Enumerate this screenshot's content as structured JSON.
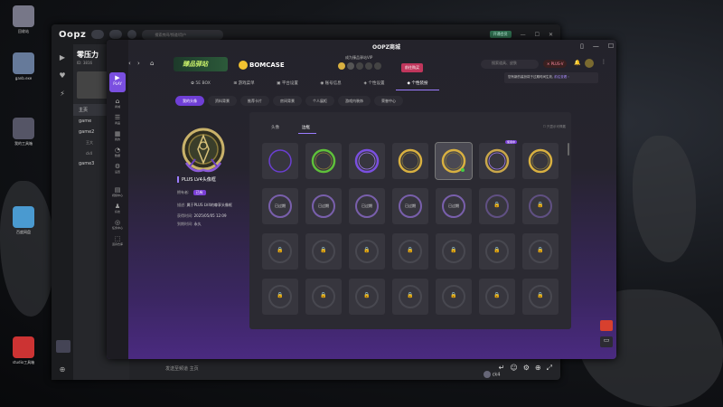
{
  "desktop": {
    "icons": [
      {
        "label": "回收站"
      },
      {
        "label": "ganb.exe"
      },
      {
        "label": "我的工具箱"
      },
      {
        "label": "百度网盘"
      },
      {
        "label": "studio工具箱"
      }
    ]
  },
  "oopz": {
    "logo": "Oopz",
    "search_placeholder": "搜索房间/频道/用户",
    "open_button": "开通会员",
    "server_name": "零压力",
    "server_id": "ID: 3816",
    "channels": [
      "主页",
      "game",
      "game2",
      "王大",
      "ck4",
      "game3"
    ],
    "chat_placeholder": "发送至频道 主页",
    "chat_user": "ck4"
  },
  "store": {
    "play_label": "PLAY",
    "title": "OOPZ商城",
    "banner_a": "臻品驿站",
    "banner_b": "BOMCASE",
    "subtitle": "成为臻品驿站VIP",
    "gold_btn": "前往购买",
    "search_placeholder": "搜索道具、皮肤",
    "plus_badge": "✕ PLUS-V",
    "tip": {
      "text": "您有新的装扮将于过期时间生效, ",
      "link": "前往查看 ›"
    },
    "nav": [
      {
        "label": "✿ 5E BOX",
        "active": false
      },
      {
        "label": "⊞ 游戏菜单",
        "active": false
      },
      {
        "label": "▣ 平台设置",
        "active": false
      },
      {
        "label": "◉ 账号信息",
        "active": false
      },
      {
        "label": "◈ 个性设置",
        "active": false
      },
      {
        "label": "◆ 个性装扮",
        "active": true
      }
    ],
    "subtabs": [
      {
        "label": "我的头像",
        "active": true
      },
      {
        "label": "资料背景",
        "active": false
      },
      {
        "label": "推荐卡片",
        "active": false
      },
      {
        "label": "房间背景",
        "active": false
      },
      {
        "label": "个人展柜",
        "active": false
      },
      {
        "label": "游戏内装饰",
        "active": false
      },
      {
        "label": "荣誉中心",
        "active": false
      }
    ],
    "left_items": [
      {
        "icon": "⌂",
        "label": "商城"
      },
      {
        "icon": "☰",
        "label": "商品"
      },
      {
        "icon": "▦",
        "label": "我的"
      },
      {
        "icon": "◔",
        "label": "数据"
      },
      {
        "icon": "⚙",
        "label": "设置"
      },
      {
        "icon": "▤",
        "label": "视频中心"
      },
      {
        "icon": "♟",
        "label": "好友"
      },
      {
        "icon": "◎",
        "label": "任务中心"
      },
      {
        "icon": "⬚",
        "label": "道具仓库"
      }
    ],
    "item": {
      "name": "PLUS LV4头像框",
      "owned_label": "拥有者:",
      "owned_badge": "已有",
      "desc_label": "描述:",
      "desc": "属于PLUS LV4的尊享头像框",
      "acquired_label": "获得时间:",
      "acquired": "2025/05/05 12:09",
      "expire_label": "到期时间:",
      "expire": "永久"
    },
    "grid": {
      "tab_a": "头像",
      "tab_b": "边框",
      "option": "只显示可佩戴",
      "expired_label": "已过期",
      "in_use_label": "使用中"
    }
  },
  "colors": {
    "accent": "#7a4fe0",
    "accent_text": "#9b7cff",
    "danger": "#c0365c",
    "gold": "#f2c230"
  }
}
